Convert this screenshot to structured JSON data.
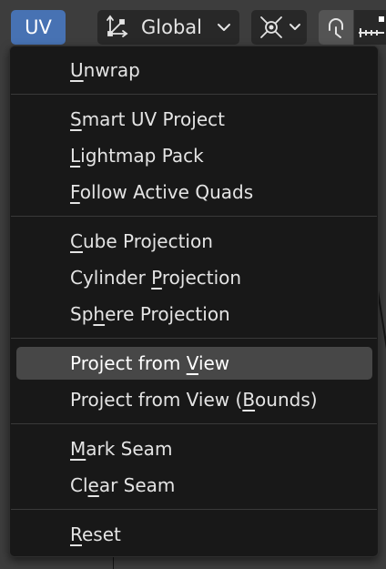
{
  "header": {
    "menu_label": "UV",
    "pivot_label": "Global"
  },
  "menu": {
    "sections": [
      [
        {
          "before": "",
          "key": "U",
          "after": "nwrap",
          "highlighted": false
        }
      ],
      [
        {
          "before": "",
          "key": "S",
          "after": "mart UV Project",
          "highlighted": false
        },
        {
          "before": "",
          "key": "L",
          "after": "ightmap Pack",
          "highlighted": false
        },
        {
          "before": "",
          "key": "F",
          "after": "ollow Active Quads",
          "highlighted": false
        }
      ],
      [
        {
          "before": "",
          "key": "C",
          "after": "ube Projection",
          "highlighted": false
        },
        {
          "before": "Cylinder ",
          "key": "P",
          "after": "rojection",
          "highlighted": false
        },
        {
          "before": "Sp",
          "key": "h",
          "after": "ere Projection",
          "highlighted": false
        }
      ],
      [
        {
          "before": "Project from ",
          "key": "V",
          "after": "iew",
          "highlighted": true
        },
        {
          "before": "Project from View (",
          "key": "B",
          "after": "ounds)",
          "highlighted": false
        }
      ],
      [
        {
          "before": "",
          "key": "M",
          "after": "ark Seam",
          "highlighted": false
        },
        {
          "before": "Cl",
          "key": "e",
          "after": "ar Seam",
          "highlighted": false
        }
      ],
      [
        {
          "before": "",
          "key": "R",
          "after": "eset",
          "highlighted": false
        }
      ]
    ]
  },
  "colors": {
    "accent": "#4772b3",
    "menu_bg": "#181818",
    "highlight": "#474747",
    "toolbar_bg": "#3d3d3d",
    "text": "#e4e4e4"
  },
  "icons": {
    "pivot": "transform-orientation-icon",
    "snap": "snap-target-icon",
    "magnet": "snap-magnet-icon",
    "increment": "snap-increment-icon",
    "chevron": "chevron-down-icon"
  }
}
